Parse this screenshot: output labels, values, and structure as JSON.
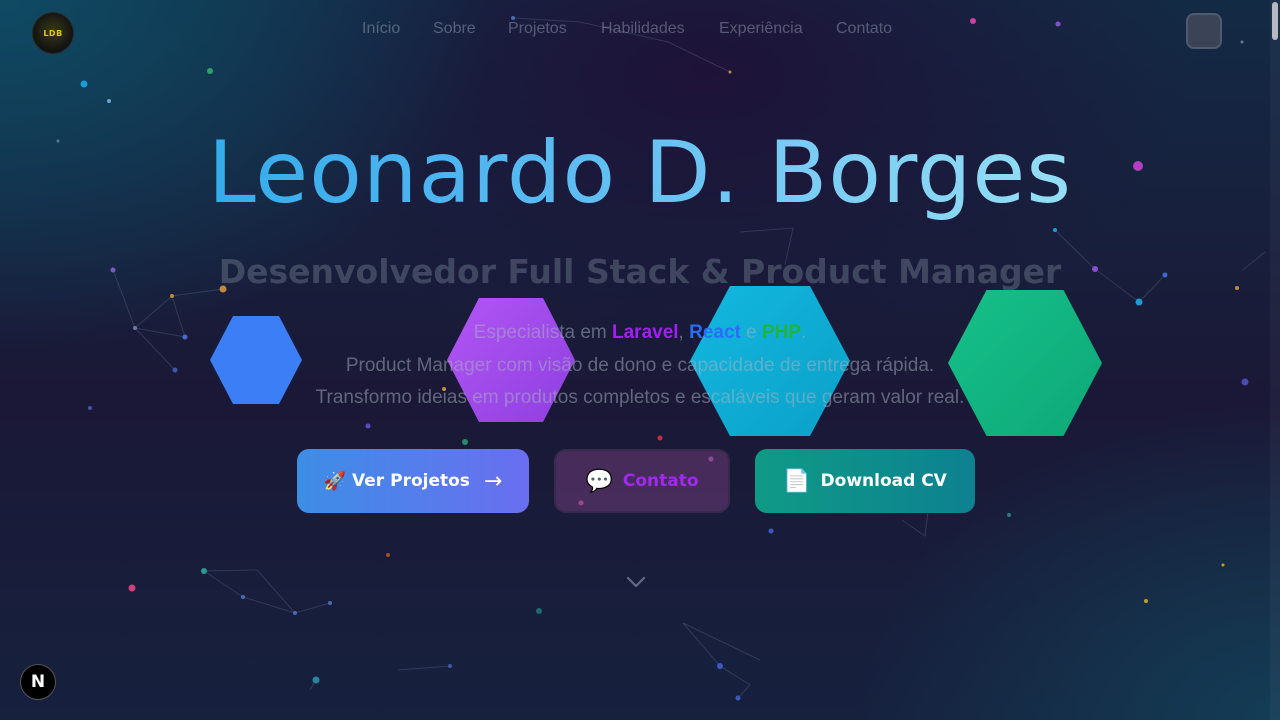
{
  "logo": {
    "text": "LDB"
  },
  "nav": {
    "items": [
      {
        "label": "Início"
      },
      {
        "label": "Sobre"
      },
      {
        "label": "Projetos"
      },
      {
        "label": "Habilidades"
      },
      {
        "label": "Experiência"
      },
      {
        "label": "Contato"
      }
    ]
  },
  "hero": {
    "name": "Leonardo D. Borges",
    "role": "Desenvolvedor Full Stack & Product Manager",
    "specialist_prefix": "Especialista em ",
    "keyword_laravel": "Laravel",
    "sep_comma": ", ",
    "keyword_react": "React",
    "sep_and": " e ",
    "keyword_php": "PHP",
    "period": ".",
    "line2": "Product Manager com visão de dono e capacidade de entrega rápida.",
    "line3": "Transformo ideias em produtos completos e escaláveis que geram valor real."
  },
  "buttons": {
    "projects": {
      "icon": "🚀",
      "label": "Ver Projetos",
      "arrow": "→"
    },
    "contact": {
      "icon": "💬",
      "label": "Contato"
    },
    "cv": {
      "icon": "📄",
      "label": "Download CV"
    }
  },
  "badge": {
    "text": "N"
  },
  "colors": {
    "laravel": "#a020ef",
    "react": "#2b6cff",
    "php": "#1fb33f",
    "hex_blue": "#3b82f6",
    "hex_purple": "#a855f7",
    "hex_cyan": "#06b6d4",
    "hex_green": "#10b981"
  },
  "icons": {
    "scroll_indicator": "chevron-down-icon",
    "theme_toggle": "theme-toggle-icon",
    "framework_badge": "next-logo-icon"
  }
}
